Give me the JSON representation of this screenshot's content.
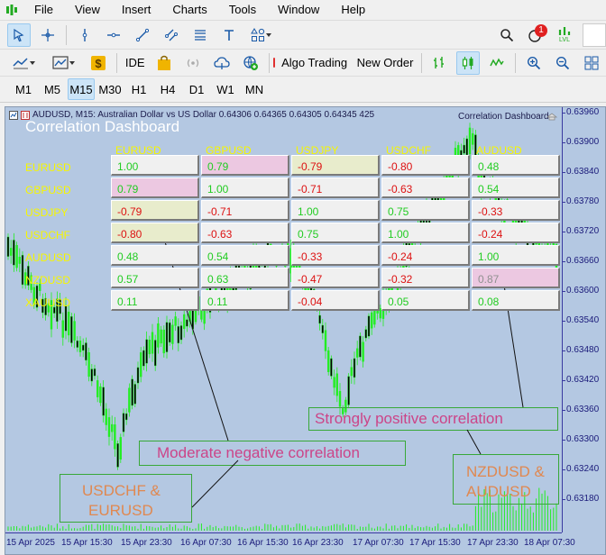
{
  "menu": [
    "File",
    "View",
    "Insert",
    "Charts",
    "Tools",
    "Window",
    "Help"
  ],
  "toolbar": {
    "algo_trading": "Algo Trading",
    "new_order": "New Order",
    "ide": "IDE",
    "notification_count": "1",
    "lvl": "LVL"
  },
  "timeframes": [
    "M1",
    "M5",
    "M15",
    "M30",
    "H1",
    "H4",
    "D1",
    "W1",
    "MN"
  ],
  "active_timeframe": "M15",
  "chart": {
    "header": "AUDUSD, M15:  Australian Dollar vs US Dollar  0.64306 0.64365 0.64305 0.64345  425",
    "ea_name": "Correlation Dashboard",
    "price_labels": [
      "0.63960",
      "0.63900",
      "0.63840",
      "0.63780",
      "0.63720",
      "0.63660",
      "0.63600",
      "0.63540",
      "0.63480",
      "0.63420",
      "0.63360",
      "0.63300",
      "0.63240",
      "0.63180"
    ],
    "time_labels": [
      "15 Apr 2025",
      "15 Apr 15:30",
      "15 Apr 23:30",
      "16 Apr 07:30",
      "16 Apr 15:30",
      "16 Apr 23:30",
      "17 Apr 07:30",
      "17 Apr 15:30",
      "17 Apr 23:30",
      "18 Apr 07:30"
    ],
    "colors": {
      "background": "#b4c8e2",
      "candle": "#22ee22",
      "axis": "#1a1a7a"
    }
  },
  "dashboard": {
    "title": "Correlation Dashboard",
    "columns": [
      "EURUSD",
      "GBPUSD",
      "USDJPY",
      "USDCHF",
      "AUDUSD"
    ],
    "rows": [
      {
        "pair": "EURUSD",
        "values": [
          "1.00",
          "0.79",
          "-0.79",
          "-0.80",
          "0.48"
        ]
      },
      {
        "pair": "GBPUSD",
        "values": [
          "0.79",
          "1.00",
          "-0.71",
          "-0.63",
          "0.54"
        ]
      },
      {
        "pair": "USDJPY",
        "values": [
          "-0.79",
          "-0.71",
          "1.00",
          "0.75",
          "-0.33"
        ]
      },
      {
        "pair": "USDCHF",
        "values": [
          "-0.80",
          "-0.63",
          "0.75",
          "1.00",
          "-0.24"
        ]
      },
      {
        "pair": "AUDUSD",
        "values": [
          "0.48",
          "0.54",
          "-0.33",
          "-0.24",
          "1.00"
        ]
      },
      {
        "pair": "NZDUSD",
        "values": [
          "0.57",
          "0.63",
          "-0.47",
          "-0.32",
          "0.87"
        ]
      },
      {
        "pair": "XAUUSD",
        "values": [
          "0.11",
          "0.11",
          "-0.04",
          "0.05",
          "0.08"
        ]
      }
    ],
    "colors": {
      "positive": "#22cc22",
      "negative": "#dd1111",
      "header": "#f6f600",
      "neutral": "#909090",
      "highlight_pink": "#ecc8e1",
      "highlight_green": "#e8eccc"
    }
  },
  "annotations": {
    "strong_positive": "Strongly positive  correlation",
    "moderate_negative": "Moderate negative correlation",
    "pair_a_line1": "USDCHF &",
    "pair_a_line2": "EURUSD",
    "pair_b_line1": "NZDUSD &",
    "pair_b_line2": "AUDUSD",
    "colors": {
      "text_pink": "#cc4488",
      "text_orange": "#e08850",
      "border": "#38a838"
    }
  }
}
